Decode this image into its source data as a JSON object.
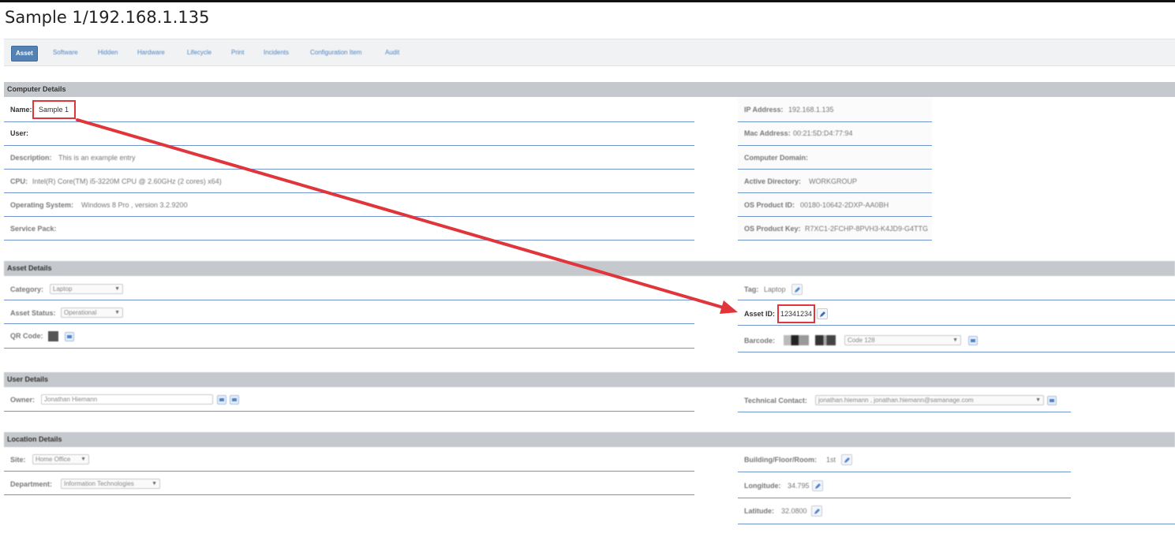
{
  "page": {
    "title": "Sample 1/192.168.1.135"
  },
  "tabs": [
    {
      "label": "Asset",
      "active": true
    },
    {
      "label": "Software"
    },
    {
      "label": "Hidden"
    },
    {
      "label": "Hardware"
    },
    {
      "label": "Lifecycle"
    },
    {
      "label": "Print"
    },
    {
      "label": "Incidents"
    },
    {
      "label": "Configuration Item"
    },
    {
      "label": "Audit"
    }
  ],
  "computer_details": {
    "header": "Computer Details",
    "name_label": "Name:",
    "name_value": "Sample 1",
    "user_label": "User:",
    "description_label": "Description:",
    "description_value": "This is an example entry",
    "cpu_label": "CPU:",
    "cpu_value": "Intel(R) Core(TM) i5-3220M CPU @ 2.60GHz (2 cores) x64)",
    "os_label": "Operating System:",
    "os_value": "Windows 8 Pro , version 3.2.9200",
    "service_pack_label": "Service Pack:",
    "ip_label": "IP Address:",
    "ip_value": "192.168.1.135",
    "mac_label": "Mac Address:",
    "mac_value": "00:21:5D:D4:77:94",
    "domain_label": "Computer Domain:",
    "ad_label": "Active Directory:",
    "ad_value": "WORKGROUP",
    "os_pid_label": "OS Product ID:",
    "os_pid_value": "00180-10642-2DXP-AA0BH",
    "os_pkey_label": "OS Product Key:",
    "os_pkey_value": "R7XC1-2FCHP-8PVH3-K4JD9-G4TTG"
  },
  "asset_details": {
    "header": "Asset Details",
    "category_label": "Category:",
    "category_value": "Laptop",
    "status_label": "Asset Status:",
    "status_value": "Operational",
    "qr_label": "QR Code:",
    "tag_label": "Tag:",
    "tag_value": "Laptop",
    "asset_id_label": "Asset ID:",
    "asset_id_value": "12341234",
    "barcode_label": "Barcode:",
    "barcode_type": "Code 128"
  },
  "user_details": {
    "header": "User Details",
    "owner_label": "Owner:",
    "owner_value": "Jonathan Hiemann",
    "tech_contact_label": "Technical Contact:",
    "tech_contact_value": "jonathan.hiemann , jonathan.hiemann@samanage.com"
  },
  "location_details": {
    "header": "Location Details",
    "site_label": "Site:",
    "site_value": "Home Office",
    "department_label": "Department:",
    "department_value": "Information Technologies",
    "building_label": "Building/Floor/Room:",
    "building_value": "1st",
    "longitude_label": "Longitude:",
    "longitude_value": "34.795",
    "latitude_label": "Latitude:",
    "latitude_value": "32.0800"
  },
  "colors": {
    "annotation": "#e0353a",
    "section_header": "#c5c9cd",
    "row_rule": "#6f95cc",
    "active_tab": "#5582b4",
    "link": "#4f86c6"
  },
  "icons": [
    "pencil-icon",
    "upload-icon",
    "arrow-annotation",
    "dropdown-arrow-icon"
  ]
}
